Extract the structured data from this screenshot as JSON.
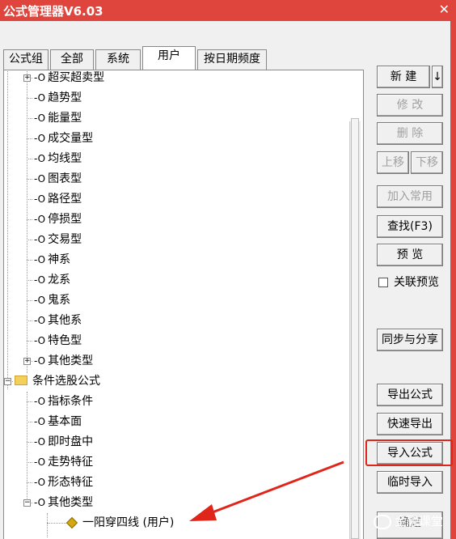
{
  "window": {
    "title": "公式管理器V6.03",
    "close_glyph": "✕",
    "accent_color": "#e0453d"
  },
  "tabs": [
    {
      "label": "公式组",
      "active": false
    },
    {
      "label": "全部",
      "active": false
    },
    {
      "label": "系统",
      "active": false
    },
    {
      "label": "用户",
      "active": true
    },
    {
      "label": "按日期频度",
      "active": false
    }
  ],
  "tree": {
    "key_icon": "-O",
    "items": [
      {
        "label": "超买超卖型",
        "expander": "+"
      },
      {
        "label": "趋势型"
      },
      {
        "label": "能量型"
      },
      {
        "label": "成交量型"
      },
      {
        "label": "均线型"
      },
      {
        "label": "图表型"
      },
      {
        "label": "路径型"
      },
      {
        "label": "停损型"
      },
      {
        "label": "交易型"
      },
      {
        "label": "神系"
      },
      {
        "label": "龙系"
      },
      {
        "label": "鬼系"
      },
      {
        "label": "其他系"
      },
      {
        "label": "特色型"
      },
      {
        "label": "其他类型",
        "expander": "+"
      },
      {
        "label": "条件选股公式",
        "expander": "-",
        "folder": true
      },
      {
        "label": "指标条件"
      },
      {
        "label": "基本面"
      },
      {
        "label": "即时盘中"
      },
      {
        "label": "走势特征"
      },
      {
        "label": "形态特征"
      },
      {
        "label": "其他类型",
        "expander": "-"
      },
      {
        "label": "一阳穿四线 (用户)",
        "formula": true
      }
    ]
  },
  "buttons": {
    "new": "新 建",
    "new_dropdown": "↓",
    "modify": "修 改",
    "delete": "删 除",
    "move_up": "上移",
    "move_down": "下移",
    "add_common": "加入常用",
    "find": "查找(F3)",
    "preview": "预 览",
    "sync_share": "同步与分享",
    "export": "导出公式",
    "quick_export": "快速导出",
    "import": "导入公式",
    "temp_import": "临时导入",
    "partial_bottom": "确定"
  },
  "checkbox": {
    "label": "关联预览",
    "checked": false
  },
  "watermark": {
    "text": "金融课堂"
  },
  "annotation": {
    "highlight_color": "#e0251b"
  }
}
